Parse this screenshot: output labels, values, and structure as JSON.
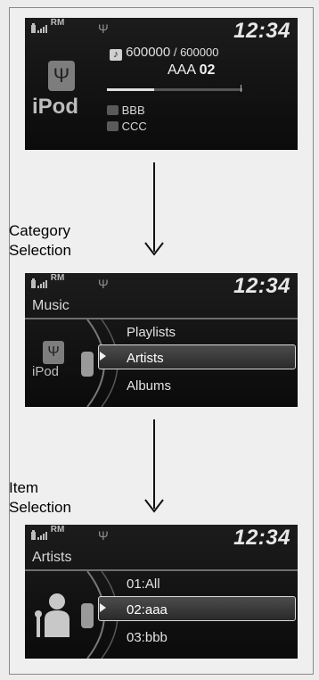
{
  "screen1": {
    "clock": "12:34",
    "rm_label": "RM",
    "track_counter": "600000",
    "track_sep": " / ",
    "track_total": "600000",
    "song_title": "AAA",
    "song_number": "02",
    "album": "BBB",
    "artist": "CCC",
    "source_label": "iPod",
    "progress": 0.35
  },
  "step1": {
    "label_line1": "Category",
    "label_line2": "Selection"
  },
  "screen2": {
    "clock": "12:34",
    "rm_label": "RM",
    "title": "Music",
    "source_label": "iPod",
    "items": [
      "Playlists",
      "Artists",
      "Albums"
    ],
    "selected_index": 1
  },
  "step2": {
    "label_line1": "Item",
    "label_line2": "Selection"
  },
  "screen3": {
    "clock": "12:34",
    "rm_label": "RM",
    "title": "Artists",
    "items": [
      "01:All",
      "02:aaa",
      "03:bbb"
    ],
    "selected_index": 1
  },
  "icons": {
    "play": "play-icon",
    "pause": "pause-icon",
    "repeat": "repeat-icon",
    "shuffle": "shuffle-icon",
    "shuffle_album": "shuffle-album-icon"
  }
}
